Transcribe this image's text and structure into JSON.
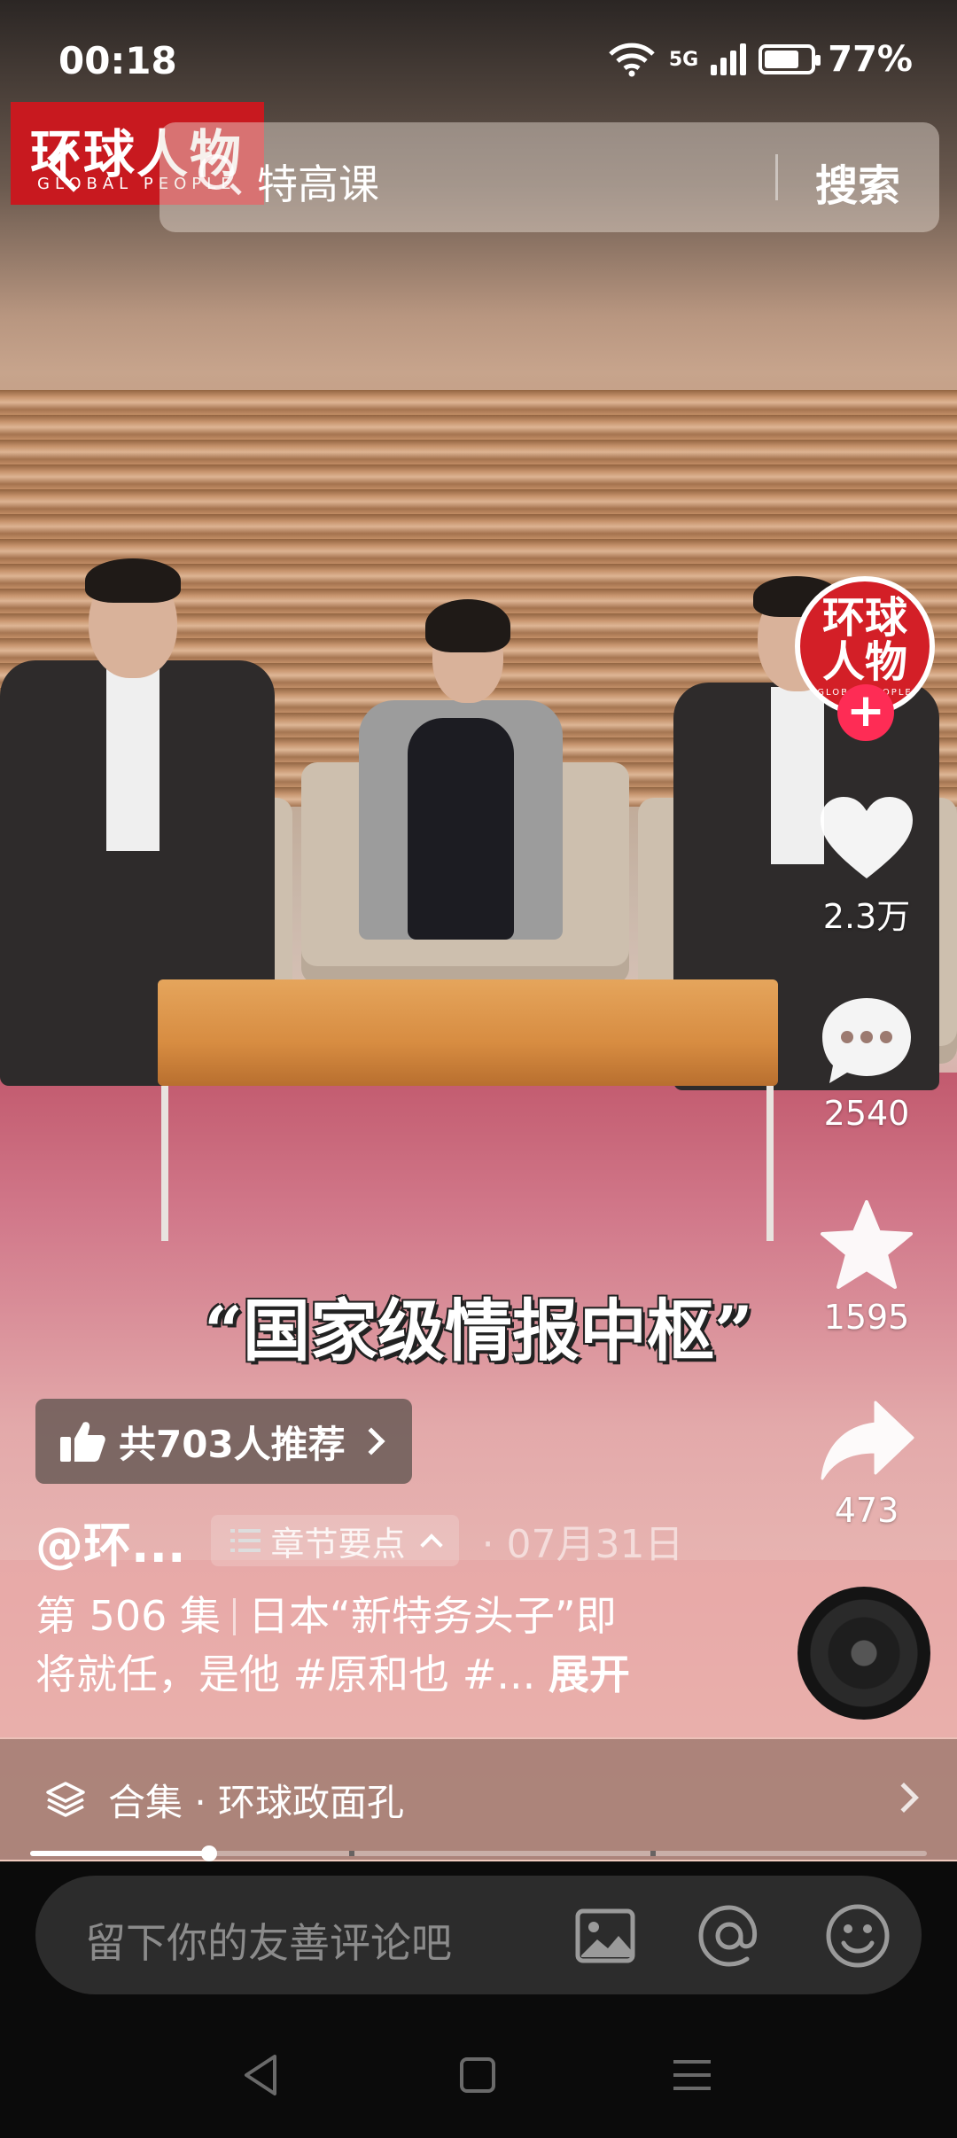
{
  "status": {
    "time": "00:18",
    "network": "5G",
    "battery": "77%"
  },
  "logo": {
    "main": "环球人物",
    "sub": "GLOBAL PEOPLE"
  },
  "search": {
    "query": "特高课",
    "button": "搜索"
  },
  "author_avatar": {
    "text_line1": "环球",
    "text_line2": "人物",
    "follow": "+"
  },
  "rail": {
    "likes": "2.3万",
    "comments": "2540",
    "favorites": "1595",
    "shares": "473"
  },
  "video": {
    "subtitle": "“国家级情报中枢”"
  },
  "recommend": {
    "label": "共703人推荐"
  },
  "info": {
    "author": "@环...",
    "chapter": "章节要点",
    "date": "· 07月31日",
    "episode": "第 506 集",
    "title_line1": "日本“新特务头子”即",
    "title_line2": "将就任，是他 #原和也 #...",
    "expand": "展开"
  },
  "collection": {
    "label": "合集 · 环球政面孔"
  },
  "progress": {
    "played": 0.2
  },
  "comment": {
    "placeholder": "留下你的友善评论吧"
  },
  "colors": {
    "accent": "#fe2c55",
    "brand_red": "#c8191f"
  }
}
